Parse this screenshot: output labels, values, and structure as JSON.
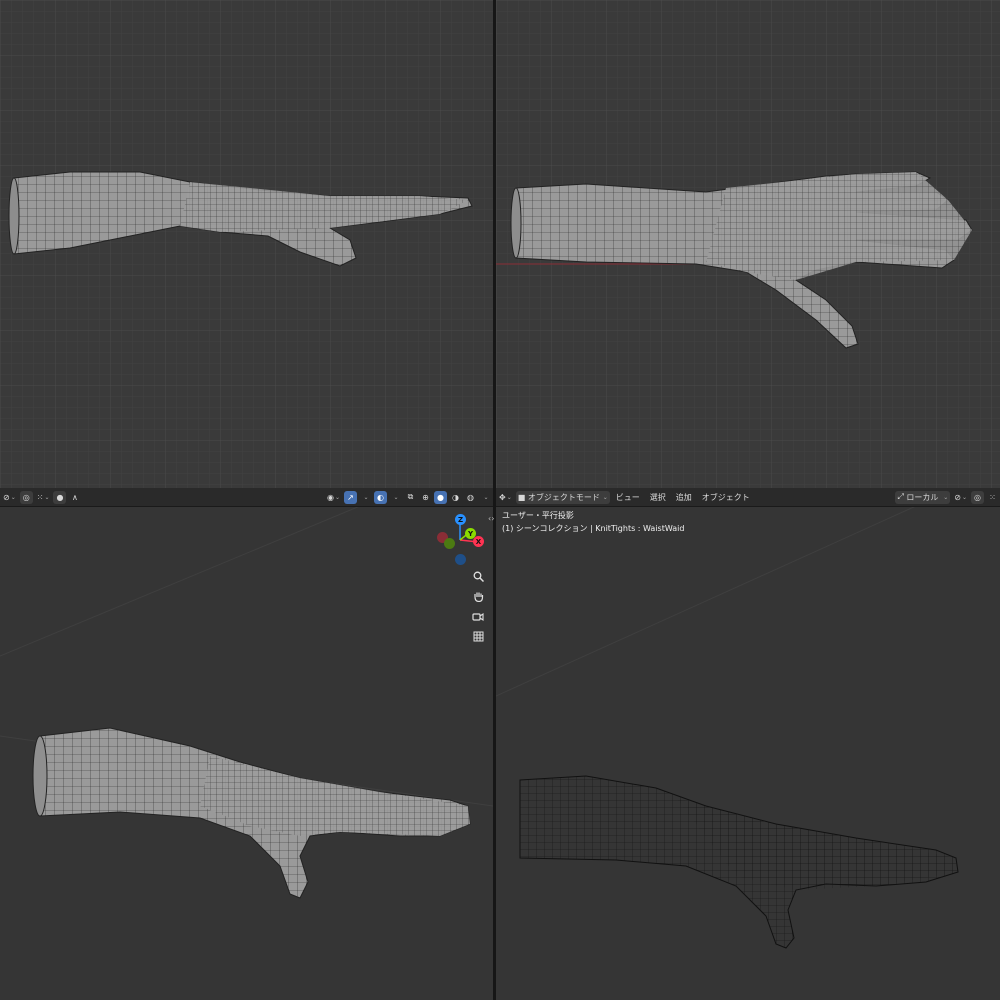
{
  "header_left": {
    "shading_modes": [
      "wireframe",
      "solid",
      "material",
      "rendered"
    ]
  },
  "header_right": {
    "mode_label": "オブジェクトモード",
    "menus": [
      "ビュー",
      "選択",
      "追加",
      "オブジェクト"
    ],
    "transform_orientation": "ローカル"
  },
  "viewport_br": {
    "view_name": "ユーザー・平行投影",
    "collection_info": "(1) シーンコレクション | KnitTights : WaistWaid"
  },
  "gizmo": {
    "z": "Z",
    "y": "Y",
    "x": "X"
  },
  "colors": {
    "x_axis": "#ff3352",
    "y_axis": "#8bdc00",
    "z_axis": "#2890ff",
    "accent": "#4772b3"
  },
  "icons": [
    "zoom-icon",
    "pan-hand-icon",
    "camera-icon",
    "grid-icon"
  ]
}
